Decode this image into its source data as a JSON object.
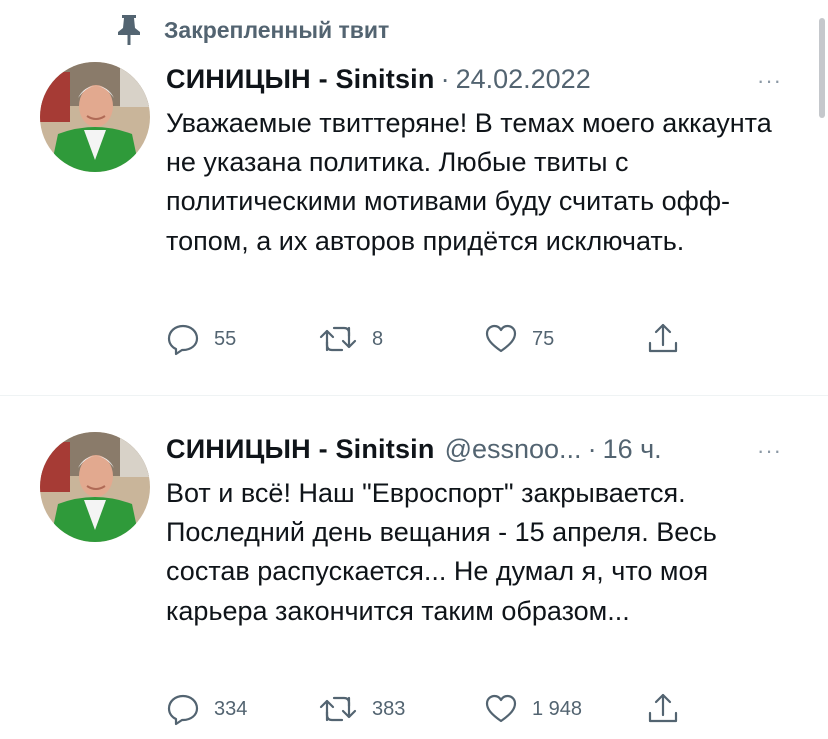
{
  "pinned": {
    "label": "Закрепленный твит",
    "icon": "pin-icon"
  },
  "tweets": [
    {
      "name": "СИНИЦЫН - Sinitsin",
      "handle": "",
      "separator": "·",
      "date": "24.02.2022",
      "text": "Уважаемые твиттеряне! В темах моего аккаунта не указана политика. Любые твиты с политическими мотивами буду считать офф-топом, а их авторов придётся исключать.",
      "replies": "55",
      "retweets": "8",
      "likes": "75"
    },
    {
      "name": "СИНИЦЫН - Sinitsin",
      "handle": "@essnoo...",
      "separator": "·",
      "date": "16 ч.",
      "text": "Вот и всё! Наш \"Евроспорт\" закрывается. Последний день вещания - 15 апреля. Весь состав распускается... Не думал я, что моя карьера закончится таким образом...",
      "replies": "334",
      "retweets": "383",
      "likes": "1 948"
    }
  ],
  "more_label": "···",
  "colors": {
    "text": "#0f1419",
    "secondary": "#536471",
    "divider": "#eff3f4",
    "jacket_green": "#2f9a3a"
  }
}
